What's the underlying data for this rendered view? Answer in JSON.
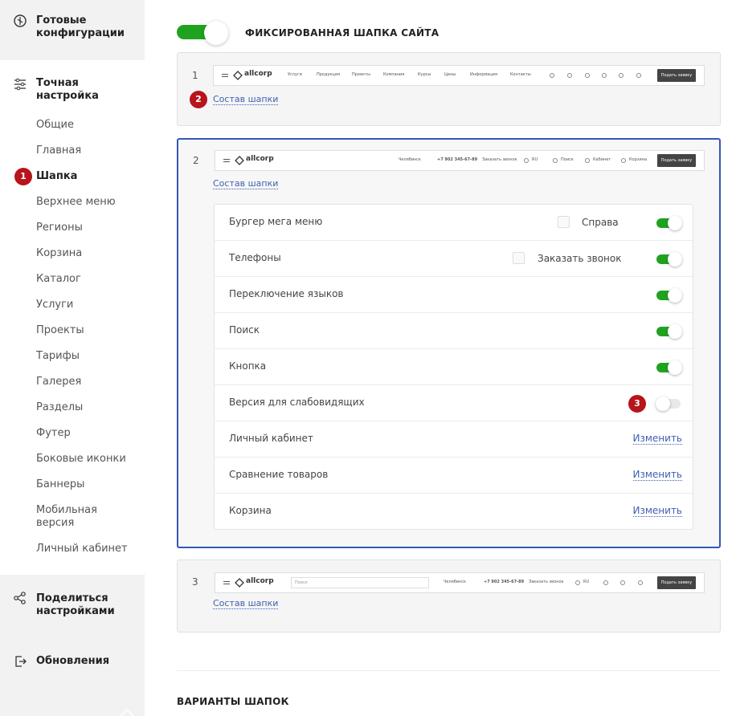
{
  "sidebar": {
    "ready_configs": "Готовые конфигурации",
    "fine_tuning": "Точная настройка",
    "items": [
      "Общие",
      "Главная",
      "Шапка",
      "Верхнее меню",
      "Регионы",
      "Корзина",
      "Каталог",
      "Услуги",
      "Проекты",
      "Тарифы",
      "Галерея",
      "Разделы",
      "Футер",
      "Боковые иконки",
      "Баннеры",
      "Мобильная версия",
      "Личный кабинет"
    ],
    "active_item": "Шапка",
    "share": "Поделиться настройками",
    "updates": "Обновления"
  },
  "badges": {
    "b1": "1",
    "b2": "2",
    "b3": "3"
  },
  "main": {
    "fixed_header_title": "ФИКСИРОВАННАЯ ШАПКА САЙТА",
    "fixed_header_on": true,
    "variants_title": "ВАРИАНТЫ ШАПОК",
    "sostav_label": "Состав шапки",
    "change_label": "Изменить",
    "variants": [
      {
        "num": "1"
      },
      {
        "num": "2"
      },
      {
        "num": "3"
      }
    ],
    "settings": [
      {
        "label": "Бургер мега меню",
        "check_label": "Справа",
        "on": true
      },
      {
        "label": "Телефоны",
        "check_label": "Заказать звонок",
        "on": true
      },
      {
        "label": "Переключение языков",
        "on": true
      },
      {
        "label": "Поиск",
        "on": true
      },
      {
        "label": "Кнопка",
        "on": true
      },
      {
        "label": "Версия для слабовидящих",
        "on": false
      },
      {
        "label": "Личный кабинет"
      },
      {
        "label": "Сравнение товаров"
      },
      {
        "label": "Корзина"
      }
    ]
  },
  "preview": {
    "logo": "allcorp",
    "menu": [
      "Услуги",
      "Продукция",
      "Проекты",
      "Компания",
      "Курсы",
      "Цены",
      "Информация",
      "Контакты"
    ],
    "button": "Подать заявку",
    "city": "Челябинск",
    "phone": "+7 902 345-67-89",
    "callback": "Заказать звонок",
    "lang": "RU",
    "search": "Поиск",
    "cabinet": "Кабинет",
    "cart": "Корзина",
    "search_placeholder": "Поиск"
  },
  "colors": {
    "accent": "#1fa31f",
    "selected_border": "#3257b8",
    "badge": "#b8141b",
    "link": "#3f5fb0"
  }
}
